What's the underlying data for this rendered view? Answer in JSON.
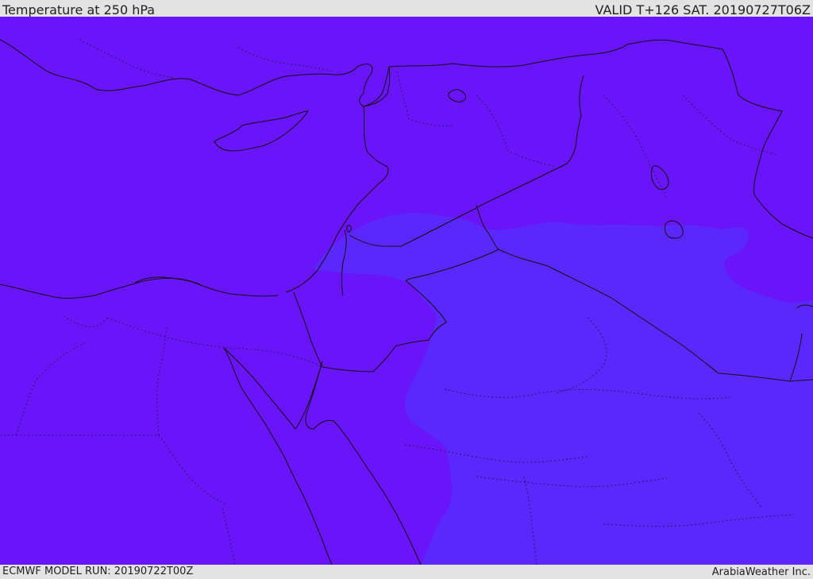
{
  "header": {
    "title": "Temperature at 250 hPa",
    "valid": "VALID T+126 SAT. 20190727T06Z"
  },
  "footer": {
    "model_run": "ECMWF MODEL RUN: 20190722T00Z",
    "credit": "ArabiaWeather Inc."
  },
  "map": {
    "colors": {
      "cold_field": "#6a14fa",
      "warm_field": "#5a28fc",
      "coast_line": "#111111",
      "border_line": "#111111",
      "admin_line": "#2a1466"
    }
  }
}
